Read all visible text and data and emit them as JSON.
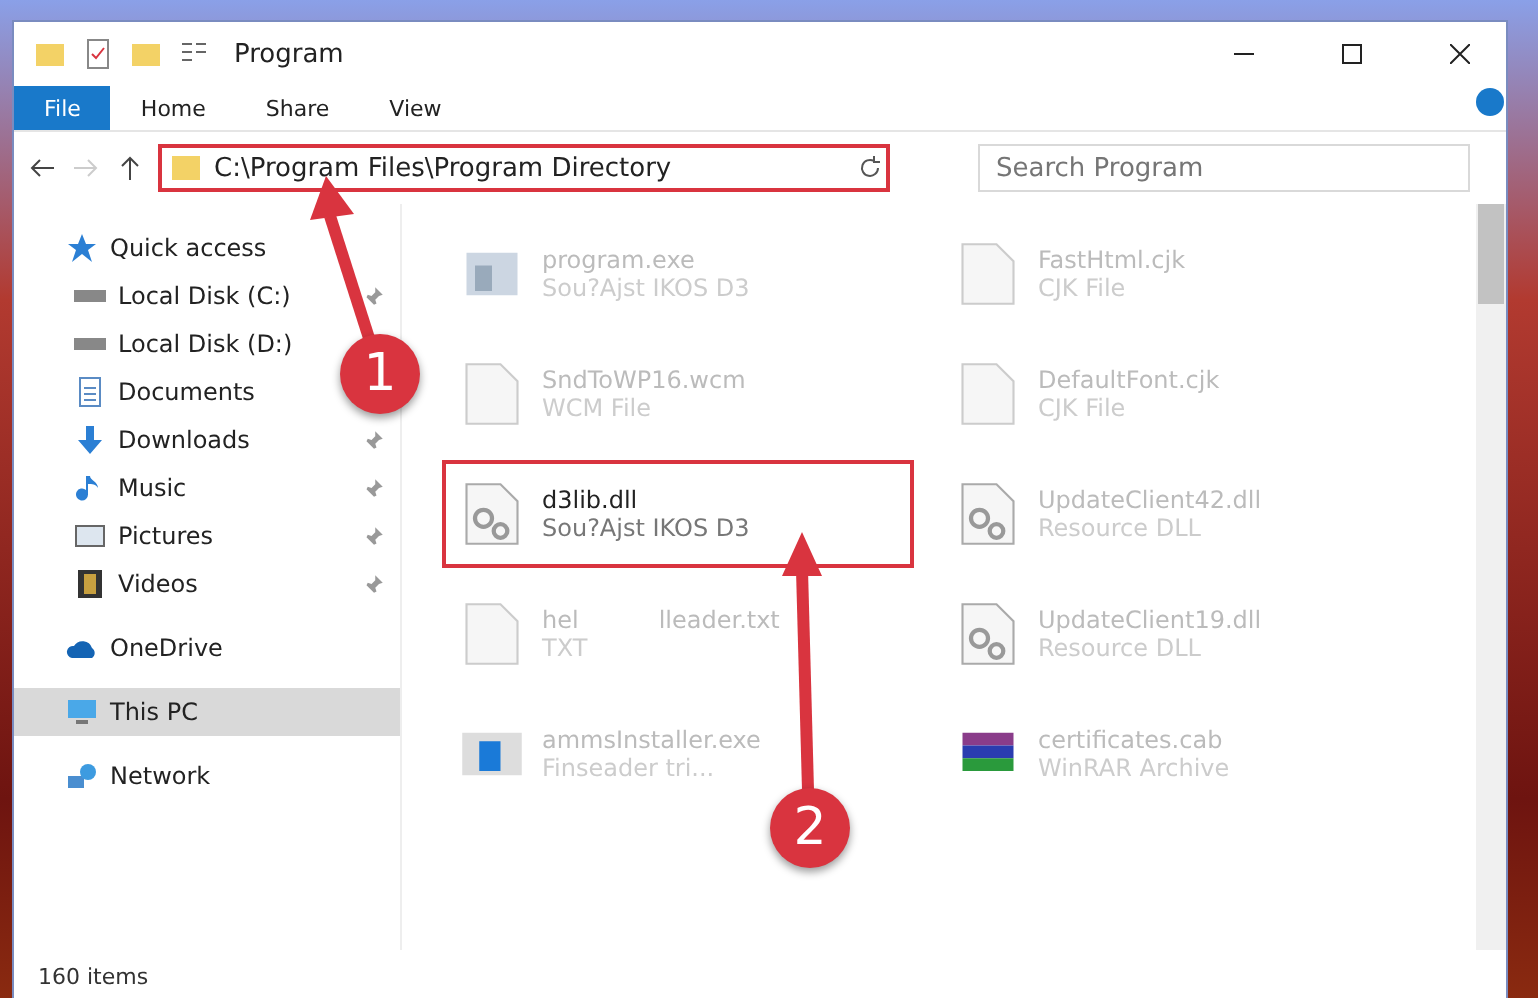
{
  "window": {
    "title": "Program"
  },
  "ribbon_tabs": [
    {
      "label": "File",
      "kind": "file"
    },
    {
      "label": "Home",
      "kind": "tab"
    },
    {
      "label": "Share",
      "kind": "tab"
    },
    {
      "label": "View",
      "kind": "tab"
    }
  ],
  "address_bar": {
    "path": "C:\\Program Files\\Program Directory",
    "highlighted": true
  },
  "search": {
    "placeholder": "Search Program"
  },
  "sidebar": {
    "items": [
      {
        "label": "Quick access",
        "kind": "star",
        "selected": false,
        "children": [
          {
            "label": "Local Disk (C:)",
            "kind": "disk",
            "selected": false,
            "pinned": true
          },
          {
            "label": "Local Disk (D:)",
            "kind": "disk",
            "selected": false
          },
          {
            "label": "Documents",
            "kind": "documents",
            "selected": false
          },
          {
            "label": "Downloads",
            "kind": "downloads",
            "selected": false,
            "pinned": true
          },
          {
            "label": "Music",
            "kind": "music",
            "selected": false,
            "pinned": true
          },
          {
            "label": "Pictures",
            "kind": "pictures",
            "selected": false,
            "pinned": true
          },
          {
            "label": "Videos",
            "kind": "videos",
            "selected": false,
            "pinned": true
          }
        ]
      },
      {
        "label": "OneDrive",
        "kind": "cloud",
        "selected": false
      },
      {
        "label": "This PC",
        "kind": "pc",
        "selected": true
      },
      {
        "label": "Network",
        "kind": "network",
        "selected": false
      }
    ]
  },
  "files": [
    {
      "name": "program.exe",
      "type": "Sou?Ajst IKOS D3",
      "kind": "exe",
      "dimmed": true,
      "highlighted": false
    },
    {
      "name": "FastHtml.cjk",
      "type": "CJK File",
      "kind": "blank",
      "dimmed": true,
      "highlighted": false
    },
    {
      "name": "SndToWP16.wcm",
      "type": "WCM File",
      "kind": "blank",
      "dimmed": true,
      "highlighted": false
    },
    {
      "name": "DefaultFont.cjk",
      "type": "CJK File",
      "kind": "blank",
      "dimmed": true,
      "highlighted": false
    },
    {
      "name": "d3lib.dll",
      "type": "Sou?Ajst IKOS D3",
      "kind": "gears",
      "dimmed": false,
      "highlighted": true
    },
    {
      "name": "UpdateClient42.dll",
      "type": "Resource DLL",
      "kind": "gears",
      "dimmed": true,
      "highlighted": false
    },
    {
      "name": "hel",
      "name_tail": "lleader.txt",
      "type": "TXT",
      "kind": "blank",
      "dimmed": true,
      "highlighted": false
    },
    {
      "name": "UpdateClient19.dll",
      "type": "Resource DLL",
      "kind": "gears",
      "dimmed": true,
      "highlighted": false
    },
    {
      "name": "ammsInstaller.exe",
      "type": "Finseader tri...",
      "kind": "installer",
      "dimmed": true,
      "highlighted": false
    },
    {
      "name": "certificates.cab",
      "type": "WinRAR Archive",
      "kind": "archive",
      "dimmed": true,
      "highlighted": false
    }
  ],
  "callouts": [
    {
      "label": "1"
    },
    {
      "label": "2"
    }
  ],
  "status_bar": {
    "items": "160 items"
  }
}
